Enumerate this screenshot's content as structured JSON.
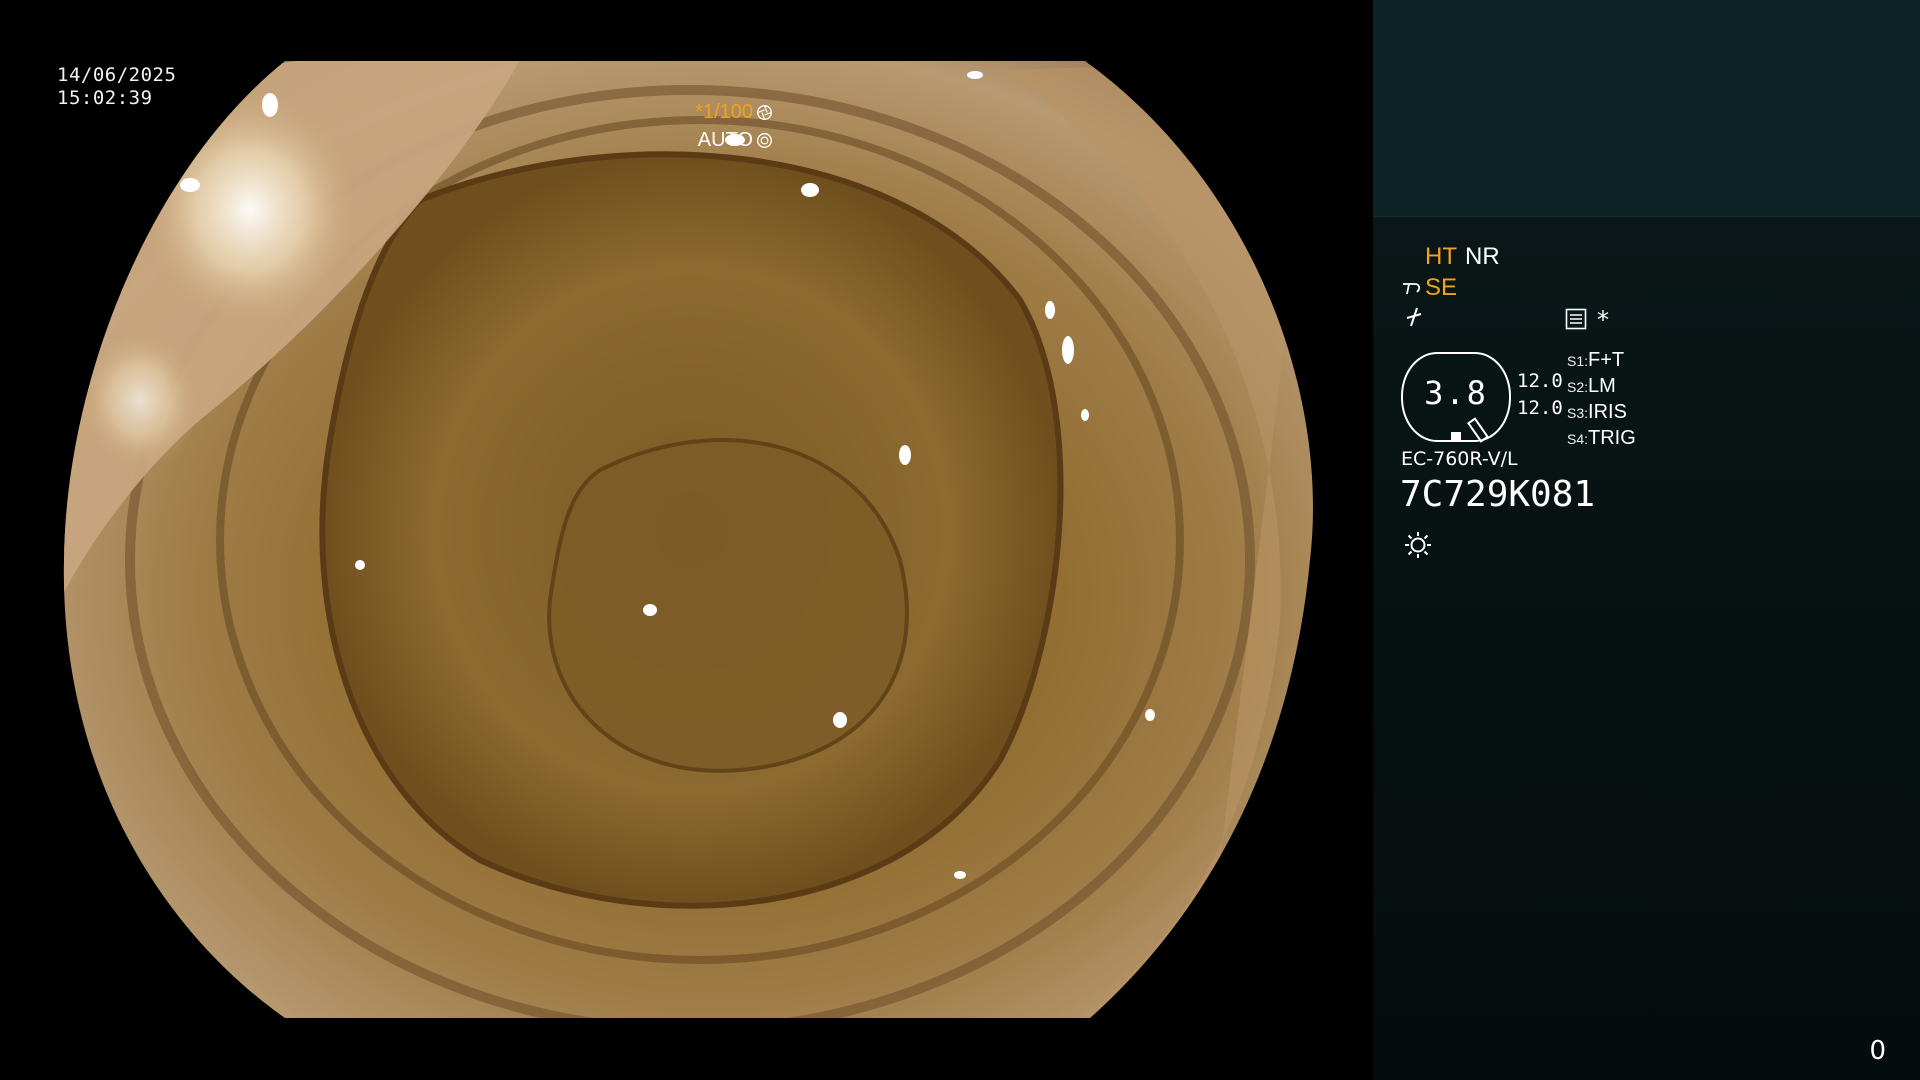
{
  "overlay": {
    "date": "14/06/2025",
    "time": "15:02:39",
    "shutter": "*1/100",
    "exposure_mode": "AUTO"
  },
  "panel": {
    "ht_label": "HT",
    "nr_label": "NR",
    "se_label": "SE",
    "zoom_value": "3.8",
    "gain_top": "12.0",
    "gain_bottom": "12.0",
    "asterisk": "*",
    "switches": [
      {
        "key": "S1:",
        "value": "F+T"
      },
      {
        "key": "S2:",
        "value": "LM"
      },
      {
        "key": "S3:",
        "value": "IRIS"
      },
      {
        "key": "S4:",
        "value": "TRIG"
      }
    ],
    "scope_model": "EC-760R-V/L",
    "serial_number": "7C729K081",
    "frame_count": "0"
  },
  "colors": {
    "accent_orange": "#f0a31d",
    "panel_top": "#0d2325",
    "panel_bg": "#061010"
  },
  "icons": [
    "shutter-icon",
    "iris-icon",
    "enhancement-icon",
    "equalizer-icon",
    "menu-icon",
    "light-icon"
  ]
}
